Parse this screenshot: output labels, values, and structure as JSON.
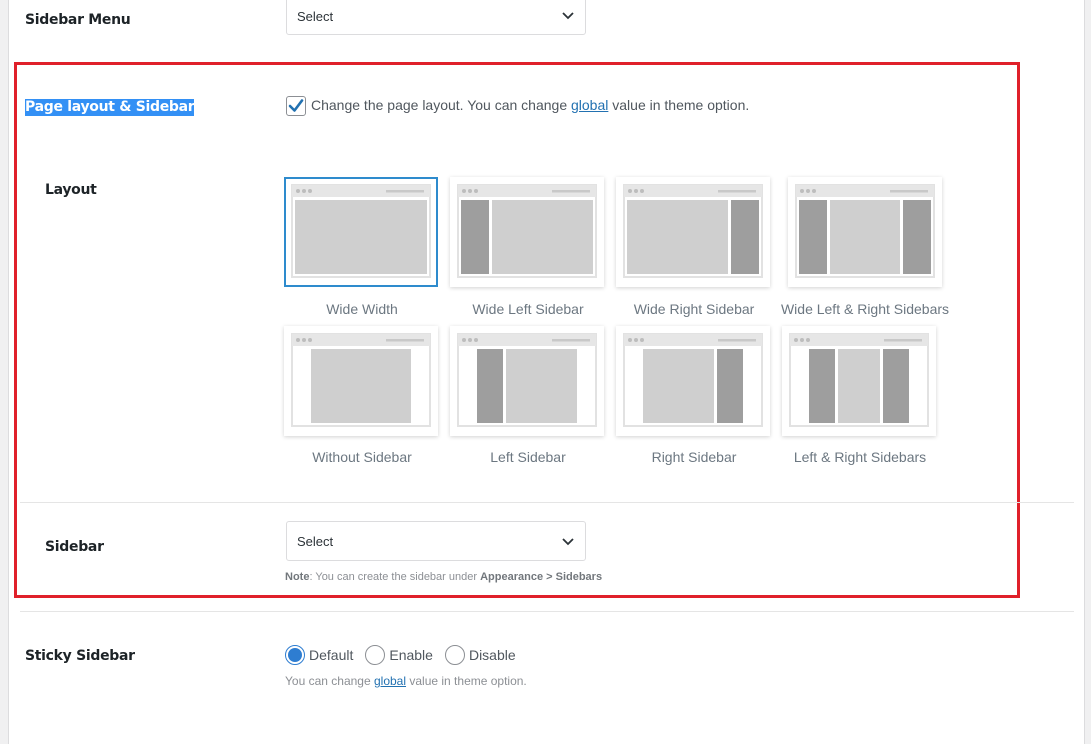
{
  "sidebar_menu": {
    "label": "Sidebar Menu",
    "select_value": "Select"
  },
  "page_layout": {
    "label": "Page layout & Sidebar",
    "checkbox_checked": true,
    "checkbox_text_before": "Change the page layout. You can change",
    "checkbox_link": "global",
    "checkbox_text_after": "value in theme option."
  },
  "layout": {
    "label": "Layout",
    "options": [
      {
        "name": "Wide Width",
        "selected": true
      },
      {
        "name": "Wide Left Sidebar",
        "selected": false
      },
      {
        "name": "Wide Right Sidebar",
        "selected": false
      },
      {
        "name": "Wide Left & Right Sidebars",
        "selected": false
      },
      {
        "name": "Without Sidebar",
        "selected": false
      },
      {
        "name": "Left Sidebar",
        "selected": false
      },
      {
        "name": "Right Sidebar",
        "selected": false
      },
      {
        "name": "Left & Right Sidebars",
        "selected": false
      }
    ]
  },
  "sidebar": {
    "label": "Sidebar",
    "select_value": "Select",
    "note_prefix": "Note",
    "note_text": ": You can create the sidebar under",
    "note_path": "Appearance > Sidebars"
  },
  "sticky_sidebar": {
    "label": "Sticky Sidebar",
    "options": [
      "Default",
      "Enable",
      "Disable"
    ],
    "selected": "Default",
    "help_before": "You can change",
    "help_link": "global",
    "help_after": "value in theme option."
  },
  "colors": {
    "highlight_border": "#e0202a",
    "selected_tile": "#2e8bcd",
    "link": "#2271b1",
    "accent": "#2e7dd1"
  }
}
